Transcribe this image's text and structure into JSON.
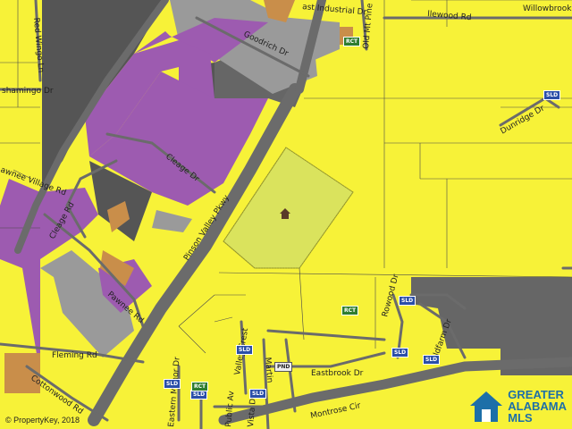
{
  "map": {
    "roads": {
      "industrial": "ast Industrial Dr",
      "old_mt_pine": "Old Mt Pine",
      "goodrich": "Goodrich Dr",
      "wood_rd": "llewood Rd",
      "willowbrook": "Willowbrook",
      "wingo": "Red Wingo Ln",
      "shamingo": "shamingo Dr",
      "pawnee_village": "awnee Village Rd",
      "cleage_rd": "Cleage Rd",
      "cleage_dr": "Cleage Dr",
      "pinson_valley": "Pinson Valley Pkwy",
      "dunridge": "Dunridge Dr",
      "pawnee_rd": "Pawnee Rd",
      "fleming": "Fleming Rd",
      "cottonwood": "Cottonwood Rd",
      "eastern_manor": "Eastern Manor Dr",
      "valley_crest": "Valley Crest",
      "oldfarm": "Oldfarm Dr",
      "rowood": "Rowood Dr",
      "eastbrook": "Eastbrook Dr",
      "montrose": "Montrose Cir",
      "public": "Public Av",
      "vista": "Vista Dr",
      "martin": "Martin"
    },
    "tags": {
      "rct": "RCT",
      "sld": "SLD",
      "pnd": "PND"
    },
    "copyright": "© PropertyKey, 2018",
    "logo_line1": "GREATER",
    "logo_line2": "ALABAMA",
    "logo_line3": "MLS",
    "colors": {
      "residential": "#f7f238",
      "commercial": "#9d5bb0",
      "industrial": "#5a5a5a",
      "office": "#9a9a9a",
      "institutional": "#c98e4a",
      "subject_parcel": "#d9e35f",
      "road": "#6b6b6b",
      "logo": "#1d6fa8"
    }
  }
}
